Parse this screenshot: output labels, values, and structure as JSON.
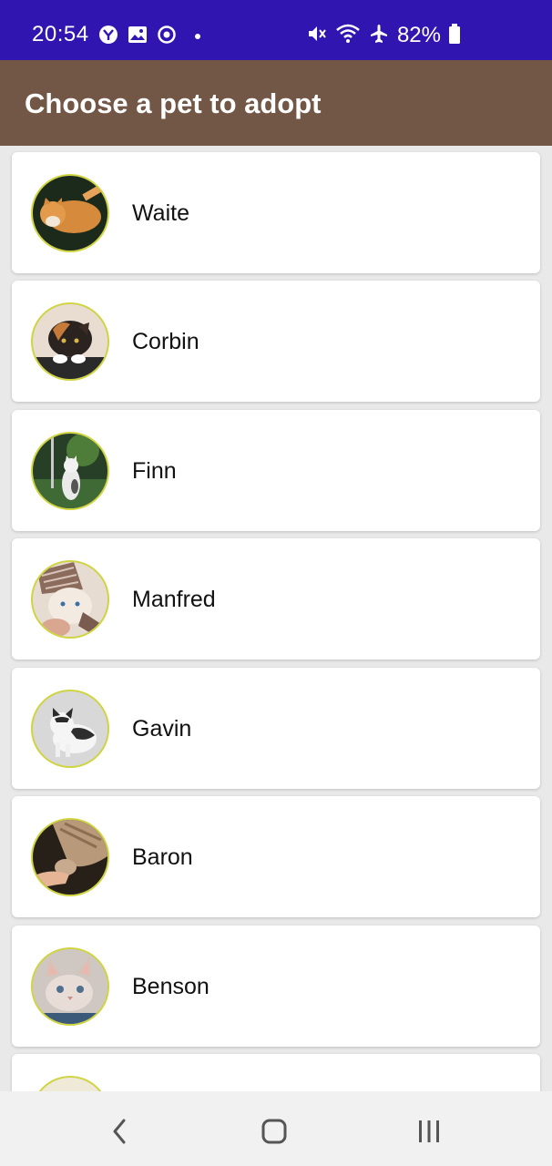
{
  "status_bar": {
    "time": "20:54",
    "left_icons": [
      "yahoo-mail-icon",
      "gallery-icon",
      "sync-icon",
      "notification-dot-icon"
    ],
    "right_icons": [
      "mute-icon",
      "wifi-icon",
      "airplane-mode-icon",
      "battery-icon"
    ],
    "battery_percent": "82%",
    "background_color": "#3115b0"
  },
  "app_bar": {
    "title": "Choose a pet to adopt",
    "background_color": "#725646"
  },
  "pets": [
    {
      "name": "Waite"
    },
    {
      "name": "Corbin"
    },
    {
      "name": "Finn"
    },
    {
      "name": "Manfred"
    },
    {
      "name": "Gavin"
    },
    {
      "name": "Baron"
    },
    {
      "name": "Benson"
    },
    {
      "name": ""
    }
  ],
  "nav_bar": {
    "buttons": [
      "back-icon",
      "home-icon",
      "recents-icon"
    ]
  },
  "colors": {
    "avatar_border": "#cfd43f",
    "card_background": "#ffffff",
    "list_background": "#e9e9e9"
  }
}
